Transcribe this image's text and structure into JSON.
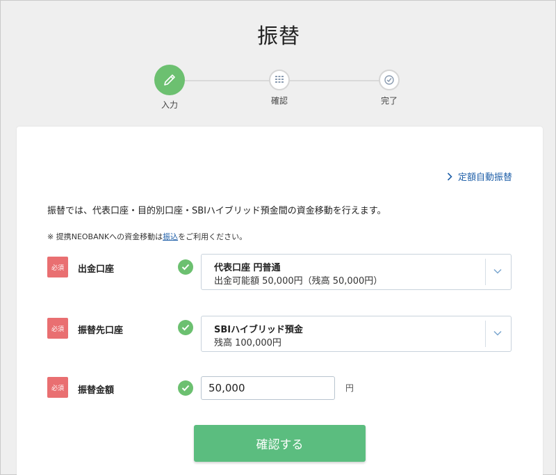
{
  "page": {
    "title": "振替"
  },
  "stepper": {
    "steps": [
      {
        "label": "入力",
        "icon": "pencil-icon",
        "state": "active"
      },
      {
        "label": "確認",
        "icon": "calculator-icon",
        "state": "pending"
      },
      {
        "label": "完了",
        "icon": "check-circle-icon",
        "state": "pending"
      }
    ]
  },
  "links": {
    "fixed_transfer": "定額自動振替"
  },
  "description": "振替では、代表口座・目的別口座・SBIハイブリッド預金間の資金移動を行えます。",
  "note": {
    "prefix": "※ 提携NEOBANKへの資金移動は",
    "link": "振込",
    "suffix": "をご利用ください。"
  },
  "form": {
    "required_badge": "必須",
    "from_account": {
      "label": "出金口座",
      "selected_main": "代表口座 円普通",
      "selected_sub": "出金可能額 50,000円（残高 50,000円）"
    },
    "to_account": {
      "label": "振替先口座",
      "selected_main": "SBIハイブリッド預金",
      "selected_sub": "残高 100,000円"
    },
    "amount": {
      "label": "振替金額",
      "value": "50,000",
      "unit": "円"
    }
  },
  "actions": {
    "confirm_label": "確認する"
  },
  "colors": {
    "accent_green": "#6cc070",
    "button_green": "#5bbd7f",
    "required_red": "#e96f71",
    "link_blue": "#1f5fa8"
  }
}
